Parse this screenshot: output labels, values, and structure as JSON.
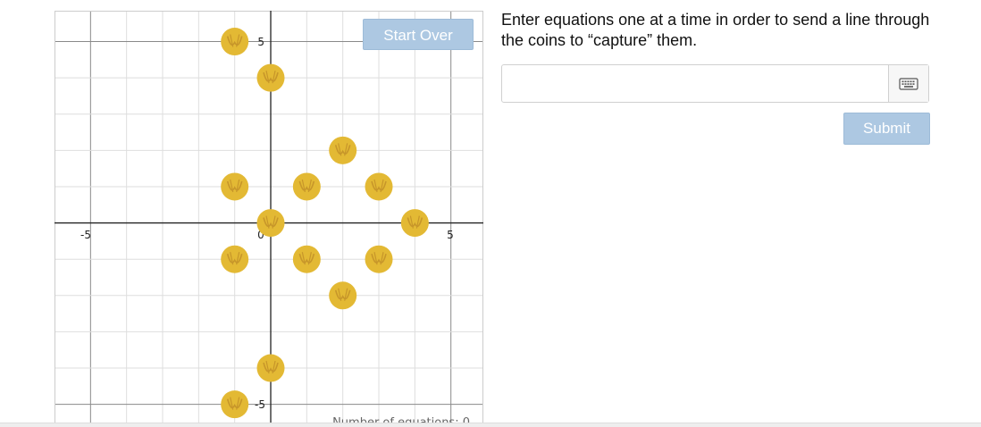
{
  "graph": {
    "x_range": [
      -6,
      5.9
    ],
    "y_range": [
      -5.6,
      5.85
    ],
    "major_ticks": [
      -5,
      5
    ],
    "origin_label": "0",
    "tick_labels": {
      "x_neg": "-5",
      "x_pos": "5",
      "y_pos": "5",
      "y_neg": "-5"
    },
    "equation_count_label": "Number of equations: 0",
    "coin_icon": "coin-icon",
    "coin_color": "#e3b934",
    "coin_symbol_color": "#c7962a",
    "grid_color": "#dedede",
    "axis_color": "#222222",
    "coins": [
      {
        "x": -1,
        "y": 5
      },
      {
        "x": 0,
        "y": 4
      },
      {
        "x": 2,
        "y": 2
      },
      {
        "x": -1,
        "y": 1
      },
      {
        "x": 1,
        "y": 1
      },
      {
        "x": 3,
        "y": 1
      },
      {
        "x": 0,
        "y": 0
      },
      {
        "x": 4,
        "y": 0
      },
      {
        "x": -1,
        "y": -1
      },
      {
        "x": 1,
        "y": -1
      },
      {
        "x": 3,
        "y": -1
      },
      {
        "x": 2,
        "y": -2
      },
      {
        "x": 0,
        "y": -4
      },
      {
        "x": -1,
        "y": -5
      }
    ]
  },
  "start_over_label": "Start Over",
  "instructions": "Enter equations one at a time in order to send a line through the coins to “capture” them.",
  "equation_input": {
    "value": "",
    "placeholder": ""
  },
  "keyboard_icon": "keyboard-icon",
  "submit_label": "Submit",
  "button_color": "#adc8e2"
}
